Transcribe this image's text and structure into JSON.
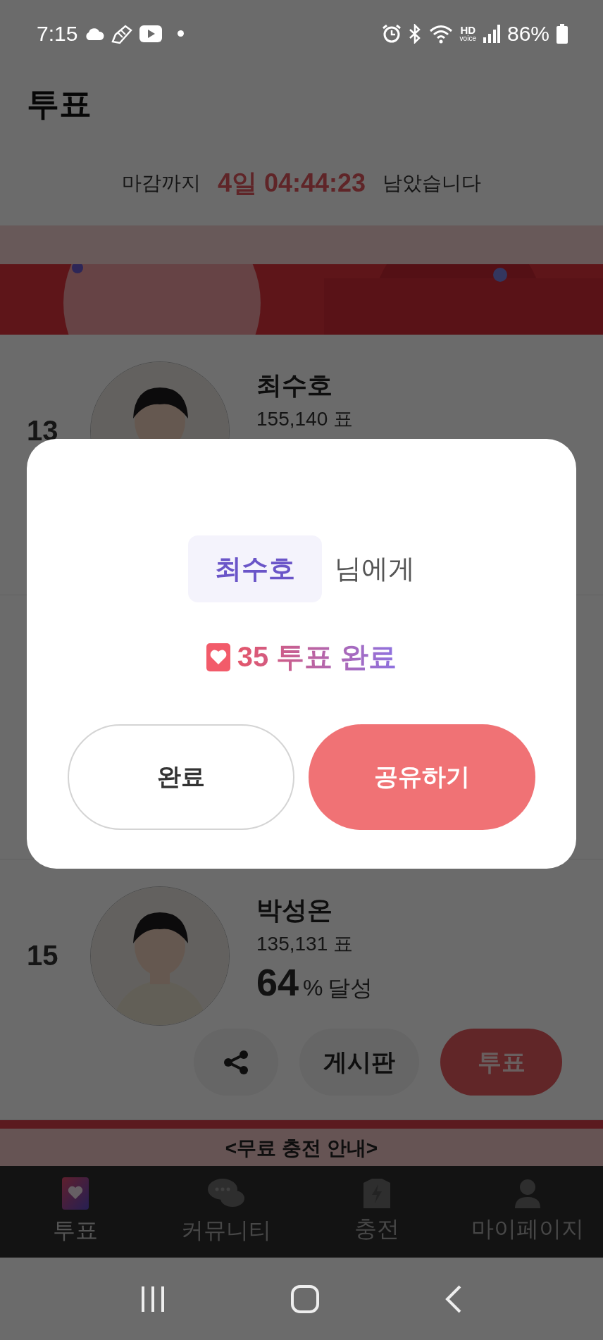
{
  "status_bar": {
    "time": "7:15",
    "hd_badge": [
      "HD",
      "voice"
    ],
    "battery": "86%"
  },
  "header": {
    "title": "투표"
  },
  "countdown": {
    "prefix": "마감까지",
    "remaining": "4일 04:44:23",
    "suffix": "남았습니다"
  },
  "candidates": [
    {
      "rank": "13",
      "name": "최수호",
      "votes": "155,140 표"
    },
    {
      "rank": "15",
      "name": "박성온",
      "votes": "135,131 표",
      "percent": "64",
      "percent_sign": "%",
      "percent_label": "달성",
      "actions": [
        {
          "kind": "share"
        },
        {
          "kind": "board",
          "label": "게시판"
        },
        {
          "kind": "vote",
          "label": "투표"
        }
      ]
    }
  ],
  "notice": {
    "title": "<무료 충전 안내>"
  },
  "modal": {
    "recipient": "최수호",
    "recipient_suffix": "님에게",
    "result": "35 투표 완료",
    "buttons": [
      {
        "kind": "outline",
        "label": "완료"
      },
      {
        "kind": "primary",
        "label": "공유하기"
      }
    ]
  },
  "bottom_nav": [
    {
      "label": "투표",
      "selected": true
    },
    {
      "label": "커뮤니티",
      "selected": false
    },
    {
      "label": "충전",
      "selected": false
    },
    {
      "label": "마이페이지",
      "selected": false
    }
  ]
}
